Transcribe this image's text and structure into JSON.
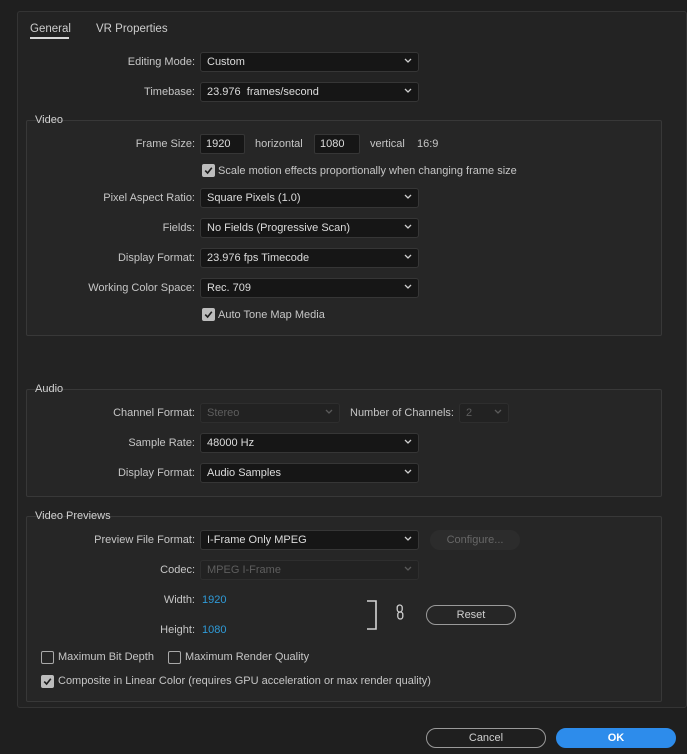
{
  "tabs": [
    {
      "label": "General"
    },
    {
      "label": "VR Properties"
    }
  ],
  "general": {
    "editing_mode": {
      "label": "Editing Mode:",
      "value": "Custom"
    },
    "timebase": {
      "label": "Timebase:",
      "value": "23.976  frames/second"
    }
  },
  "video": {
    "title": "Video",
    "frame_size": {
      "label": "Frame Size:",
      "width": "1920",
      "horizontal_label": "horizontal",
      "height": "1080",
      "vertical_label": "vertical",
      "ratio": "16:9"
    },
    "scale_motion": {
      "label": "Scale motion effects proportionally when changing frame size",
      "checked": true
    },
    "pixel_aspect_ratio": {
      "label": "Pixel Aspect Ratio:",
      "value": "Square Pixels (1.0)"
    },
    "fields": {
      "label": "Fields:",
      "value": "No Fields (Progressive Scan)"
    },
    "display_format": {
      "label": "Display Format:",
      "value": "23.976 fps Timecode"
    },
    "working_color_space": {
      "label": "Working Color Space:",
      "value": "Rec. 709"
    },
    "auto_tone_map": {
      "label": "Auto Tone Map Media",
      "checked": true
    }
  },
  "audio": {
    "title": "Audio",
    "channel_format": {
      "label": "Channel Format:",
      "value": "Stereo"
    },
    "number_of_channels": {
      "label": "Number of Channels:",
      "value": "2"
    },
    "sample_rate": {
      "label": "Sample Rate:",
      "value": "48000 Hz"
    },
    "display_format": {
      "label": "Display Format:",
      "value": "Audio Samples"
    }
  },
  "video_previews": {
    "title": "Video Previews",
    "preview_file_format": {
      "label": "Preview File Format:",
      "value": "I-Frame Only MPEG"
    },
    "configure_button": "Configure...",
    "codec": {
      "label": "Codec:",
      "value": "MPEG I-Frame"
    },
    "width": {
      "label": "Width:",
      "value": "1920"
    },
    "height": {
      "label": "Height:",
      "value": "1080"
    },
    "reset_button": "Reset",
    "maximum_bit_depth": {
      "label": "Maximum Bit Depth",
      "checked": false
    },
    "maximum_render_quality": {
      "label": "Maximum Render Quality",
      "checked": false
    },
    "composite_linear": {
      "label": "Composite in Linear Color (requires GPU acceleration or max render quality)",
      "checked": true
    }
  },
  "footer": {
    "cancel_button": "Cancel",
    "ok_button": "OK"
  },
  "colors": {
    "accent": "#2d8ceb",
    "link_value": "#2f9bd8",
    "background": "#1f1f1f"
  },
  "icons": [
    "chevron-down-icon",
    "checkmark-icon",
    "chain-link-icon"
  ]
}
